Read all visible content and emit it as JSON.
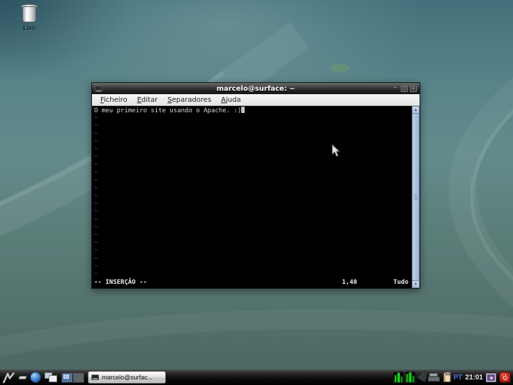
{
  "desktop": {
    "trash": {
      "label": "Lixo"
    }
  },
  "window": {
    "title": "marcelo@surface: ~",
    "controls": {
      "minimize": "−",
      "maximize": "□",
      "close": "×"
    },
    "menu": [
      {
        "first": "F",
        "rest": "icheiro"
      },
      {
        "first": "E",
        "rest": "ditar"
      },
      {
        "first": "S",
        "rest": "eparadores"
      },
      {
        "first": "A",
        "rest": "juda"
      }
    ]
  },
  "terminal": {
    "line1": "O meu primeiro site usando o Apache. :)",
    "tilde": "~",
    "tilde_count": 21,
    "status": {
      "mode": "-- INSERÇÃO --",
      "ruler": "1,40",
      "scroll": "Tudo"
    }
  },
  "icons": {
    "arrow_up": "▲",
    "arrow_down": "▼"
  },
  "taskbar": {
    "task_button": {
      "label": "marcelo@surfac..."
    },
    "tray": {
      "keyboard_layout": "PT",
      "clock": "21:01"
    }
  },
  "colors": {
    "desktop_teal": "#578288",
    "tilde_blue": "#4446cd",
    "scrollbar_blue": "#9bb5d6",
    "power_red": "#c01e12",
    "keyboard_blue": "#4a66d8"
  }
}
